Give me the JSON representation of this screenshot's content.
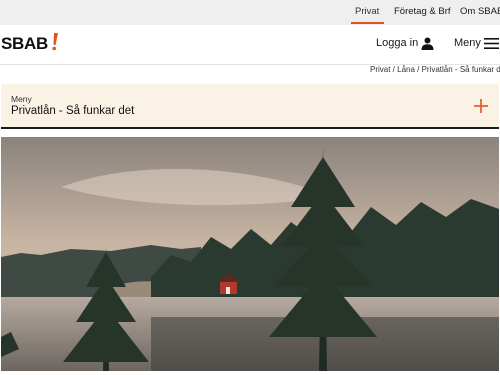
{
  "topbar": {
    "links": [
      "Privat",
      "Företag & Brf",
      "Om SBAB"
    ],
    "active_color": "#e2531c"
  },
  "header": {
    "logo_text": "SBAB",
    "logo_accent": "#e2531c",
    "login_label": "Logga in",
    "menu_label": "Meny",
    "user_icon": "user-icon",
    "menu_icon": "hamburger-icon"
  },
  "breadcrumb": "Privat / Låna / Privatlån - Så funkar det",
  "subnav": {
    "label": "Meny",
    "title": "Privatlån - Så funkar det",
    "expand_icon": "plus-icon",
    "background": "#fbf2e6"
  },
  "hero": {
    "icon": "lake-landscape-image"
  }
}
